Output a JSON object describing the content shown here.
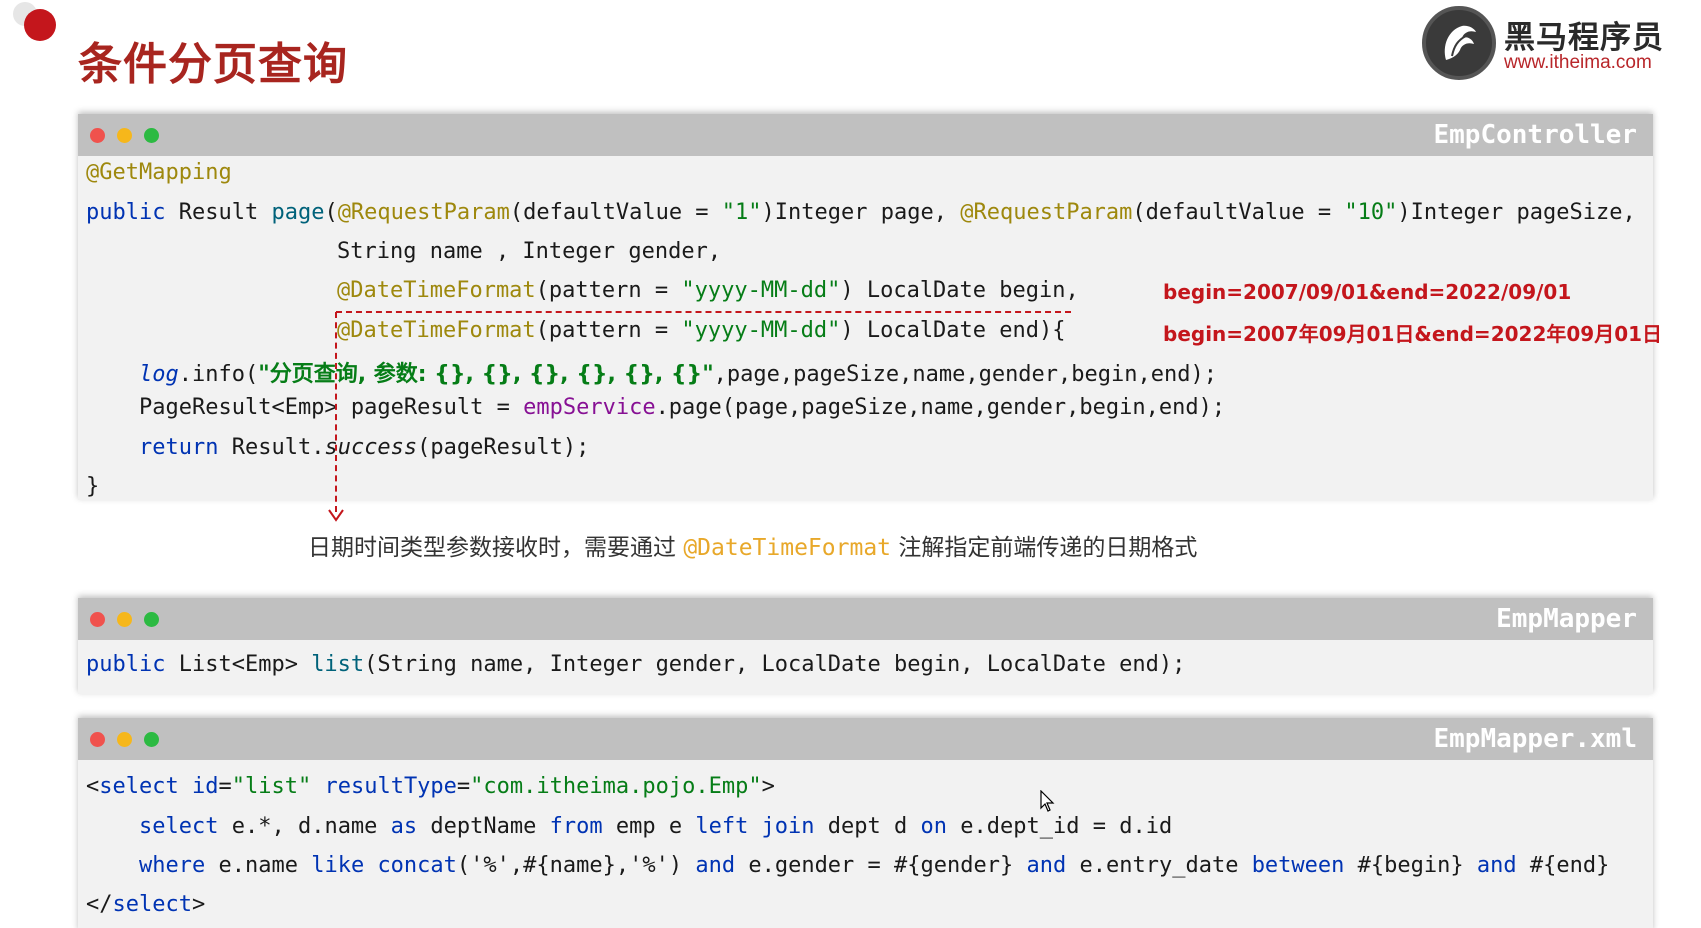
{
  "title": "条件分页查询",
  "logo": {
    "name": "黑马程序员",
    "url": "www.itheima.com"
  },
  "panels": {
    "controller": {
      "title": "EmpController",
      "lines": {
        "l1": "@GetMapping",
        "l2_kw": "public",
        "l2_a": " Result ",
        "l2_fn": "page",
        "l2_b": "(",
        "l2_ann1": "@RequestParam",
        "l2_c": "(defaultValue = ",
        "l2_s1": "\"1\"",
        "l2_d": ")Integer page, ",
        "l2_ann2": "@RequestParam",
        "l2_e": "(defaultValue = ",
        "l2_s2": "\"10\"",
        "l2_f": ")Integer pageSize,",
        "l3": "String name , Integer gender,",
        "l4_ann": "@DateTimeFormat",
        "l4_a": "(pattern = ",
        "l4_s": "\"yyyy-MM-dd\"",
        "l4_b": ") LocalDate begin,",
        "l5_ann": "@DateTimeFormat",
        "l5_a": "(pattern = ",
        "l5_s": "\"yyyy-MM-dd\"",
        "l5_b": ") LocalDate end){",
        "l6_log": "log",
        "l6_a": ".info(",
        "l6_s": "\"分页查询, 参数: {}, {}, {}, {}, {}, {}\"",
        "l6_b": ",page,pageSize,name,gender,begin,end);",
        "l7_a": "PageResult<Emp> pageResult = ",
        "l7_field": "empService",
        "l7_b": ".page(page,pageSize,name,gender,begin,end);",
        "l8_kw": "return",
        "l8_a": " Result.",
        "l8_it": "success",
        "l8_b": "(pageResult);",
        "l9": "}"
      },
      "notes": {
        "n1": "begin=2007/09/01&end=2022/09/01",
        "n2": "begin=2007年09月01日&end=2022年09月01日"
      }
    },
    "caption": {
      "before": "日期时间类型参数接收时，需要通过 ",
      "ann": "@DateTimeFormat",
      "after": " 注解指定前端传递的日期格式"
    },
    "mapper": {
      "title": "EmpMapper",
      "l_kw": "public",
      "l_a": " List<Emp> ",
      "l_fn": "list",
      "l_b": "(String name, Integer gender, LocalDate begin, LocalDate end);"
    },
    "xml": {
      "title": "EmpMapper.xml",
      "x1_a": "<",
      "x1_tag": "select",
      "x1_b": " ",
      "x1_attr1": "id",
      "x1_c": "=",
      "x1_v1": "\"list\"",
      "x1_d": " ",
      "x1_attr2": "resultType",
      "x1_e": "=",
      "x1_v2": "\"com.itheima.pojo.Emp\"",
      "x1_f": ">",
      "x2_kw1": "select",
      "x2_a": " e.*, d.name ",
      "x2_kw2": "as",
      "x2_b": " deptName ",
      "x2_kw3": "from",
      "x2_c": " emp e ",
      "x2_kw4": "left join",
      "x2_d": " dept d ",
      "x2_kw5": "on",
      "x2_e": " e.dept_id = d.id",
      "x3_kw1": "where",
      "x3_a": " e.name ",
      "x3_kw2": "like",
      "x3_sp": " ",
      "x3_fn": "concat",
      "x3_b": "('%',#{name},'%') ",
      "x3_kw3": "and",
      "x3_c": " e.gender = #{gender} ",
      "x3_kw4": "and",
      "x3_d": " e.entry_date ",
      "x3_kw5": "between",
      "x3_e": " #{begin} ",
      "x3_kw6": "and",
      "x3_f": " #{end}",
      "x4_a": "</",
      "x4_tag": "select",
      "x4_b": ">"
    }
  }
}
